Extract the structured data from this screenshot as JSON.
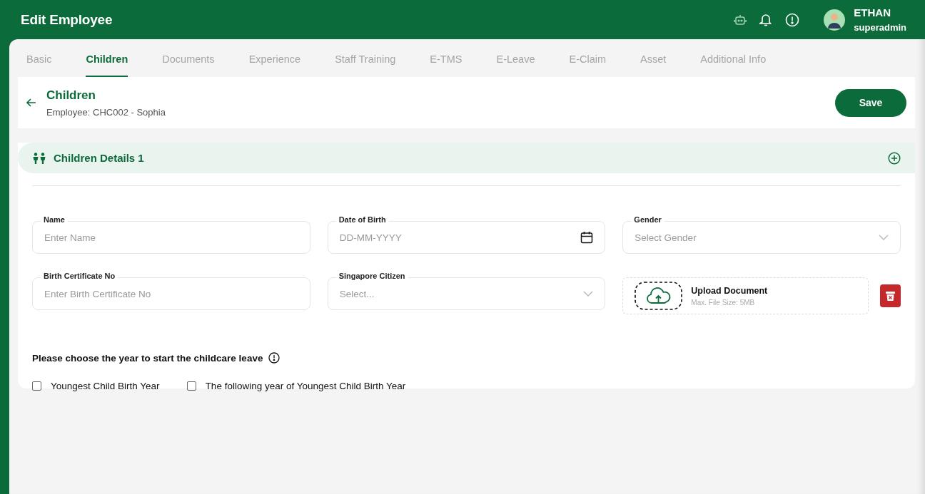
{
  "header": {
    "title": "Edit Employee",
    "user": {
      "name": "ETHAN",
      "role": "superadmin"
    }
  },
  "tabs": [
    {
      "label": "Basic",
      "selected": false
    },
    {
      "label": "Children",
      "selected": true
    },
    {
      "label": "Documents",
      "selected": false
    },
    {
      "label": "Experience",
      "selected": false
    },
    {
      "label": "Staff Training",
      "selected": false
    },
    {
      "label": "E-TMS",
      "selected": false
    },
    {
      "label": "E-Leave",
      "selected": false
    },
    {
      "label": "E-Claim",
      "selected": false
    },
    {
      "label": "Asset",
      "selected": false
    },
    {
      "label": "Additional Info",
      "selected": false
    }
  ],
  "page": {
    "title": "Children",
    "subtitle": "Employee: CHC002 - Sophia",
    "save": "Save"
  },
  "section": {
    "title": "Children Details 1",
    "fields": [
      {
        "kind": "text",
        "label": "Name",
        "placeholder": "Enter Name"
      },
      {
        "kind": "date",
        "label": "Date of Birth",
        "placeholder": "DD-MM-YYYY"
      },
      {
        "kind": "select",
        "label": "Gender",
        "placeholder": "Select Gender"
      },
      {
        "kind": "text",
        "label": "Birth Certificate No",
        "placeholder": "Enter Birth Certificate No"
      },
      {
        "kind": "select",
        "label": "Singapore Citizen",
        "placeholder": "Select..."
      },
      {
        "kind": "upload",
        "title": "Upload Document",
        "hint": "Max. File Size: 5MB"
      }
    ],
    "question": "Please choose the year to start the childcare leave",
    "options": [
      {
        "label": "Youngest Child Birth Year",
        "checked": false
      },
      {
        "label": "The following year of Youngest Child Birth Year",
        "checked": false
      }
    ]
  }
}
